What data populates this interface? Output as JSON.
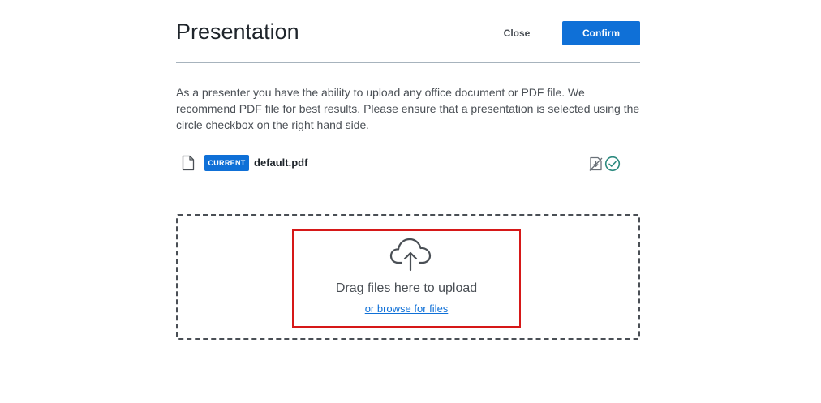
{
  "modal": {
    "title": "Presentation",
    "close_label": "Close",
    "confirm_label": "Confirm",
    "description": "As a presenter you have the ability to upload any office document or PDF file. We recommend PDF file for best results. Please ensure that a presentation is selected using the circle checkbox on the right hand side."
  },
  "files": [
    {
      "badge": "CURRENT",
      "name": "default.pdf",
      "icons": [
        "file-icon",
        "download-disabled-icon",
        "checkmark-circle-icon"
      ]
    }
  ],
  "dropzone": {
    "icon": "cloud-upload-icon",
    "text": "Drag files here to upload",
    "browse_label": "or browse for files"
  },
  "colors": {
    "primary": "#0f70d7",
    "highlight_border": "#d61818",
    "selected_check": "#2c8a7f",
    "divider": "#a7b3bd"
  }
}
